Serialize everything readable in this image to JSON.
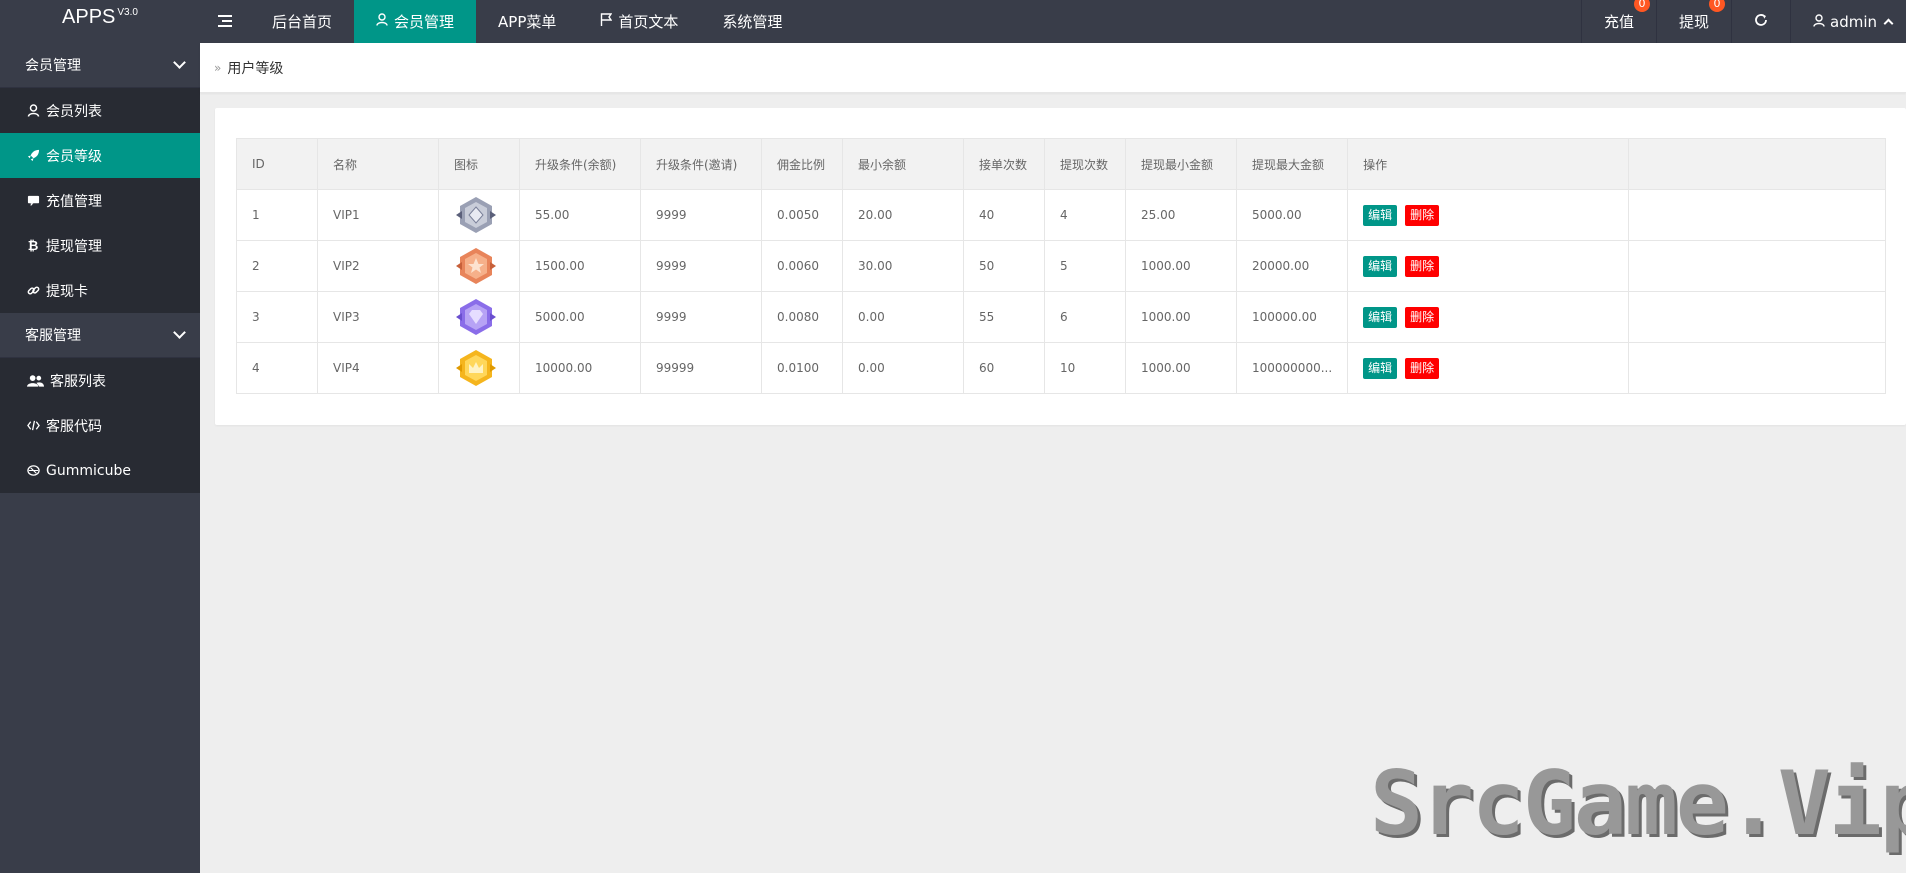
{
  "app": {
    "name": "APPS",
    "version": "V3.0"
  },
  "topnav": [
    {
      "label": "后台首页",
      "icon": "menu-toggle-icon",
      "active": false
    },
    {
      "label": "会员管理",
      "icon": "user-icon",
      "active": true
    },
    {
      "label": "APP菜单",
      "icon": "",
      "active": false
    },
    {
      "label": "首页文本",
      "icon": "flag-icon",
      "active": false
    },
    {
      "label": "系统管理",
      "icon": "",
      "active": false
    }
  ],
  "topright": {
    "recharge": {
      "label": "充值",
      "count": "0"
    },
    "withdraw": {
      "label": "提现",
      "count": "0"
    },
    "user": "admin"
  },
  "sidebar": {
    "group1": "会员管理",
    "items1": [
      "会员列表",
      "会员等级",
      "充值管理",
      "提现管理",
      "提现卡"
    ],
    "group2": "客服管理",
    "items2": [
      "客服列表",
      "客服代码",
      "Gummicube"
    ]
  },
  "breadcrumb": "用户等级",
  "table": {
    "headers": [
      "ID",
      "名称",
      "图标",
      "升级条件(余额)",
      "升级条件(邀请)",
      "佣金比例",
      "最小余额",
      "接单次数",
      "提现次数",
      "提现最小金额",
      "提现最大金额",
      "操作"
    ],
    "rows": [
      {
        "id": "1",
        "name": "VIP1",
        "medal": "silver",
        "balance": "55.00",
        "invite": "9999",
        "rate": "0.0050",
        "min": "20.00",
        "orders": "40",
        "withdraws": "4",
        "wmin": "25.00",
        "wmax": "5000.00"
      },
      {
        "id": "2",
        "name": "VIP2",
        "medal": "bronze",
        "balance": "1500.00",
        "invite": "9999",
        "rate": "0.0060",
        "min": "30.00",
        "orders": "50",
        "withdraws": "5",
        "wmin": "1000.00",
        "wmax": "20000.00"
      },
      {
        "id": "3",
        "name": "VIP3",
        "medal": "purple",
        "balance": "5000.00",
        "invite": "9999",
        "rate": "0.0080",
        "min": "0.00",
        "orders": "55",
        "withdraws": "6",
        "wmin": "1000.00",
        "wmax": "100000.00"
      },
      {
        "id": "4",
        "name": "VIP4",
        "medal": "gold",
        "balance": "10000.00",
        "invite": "99999",
        "rate": "0.0100",
        "min": "0.00",
        "orders": "60",
        "withdraws": "10",
        "wmin": "1000.00",
        "wmax": "100000000..."
      }
    ],
    "edit_label": "编辑",
    "delete_label": "删除"
  },
  "watermark": "SrcGame.Vip",
  "colors": {
    "accent": "#009688",
    "dark": "#393d49",
    "danger": "#ff0000",
    "badge": "#ff5722"
  }
}
